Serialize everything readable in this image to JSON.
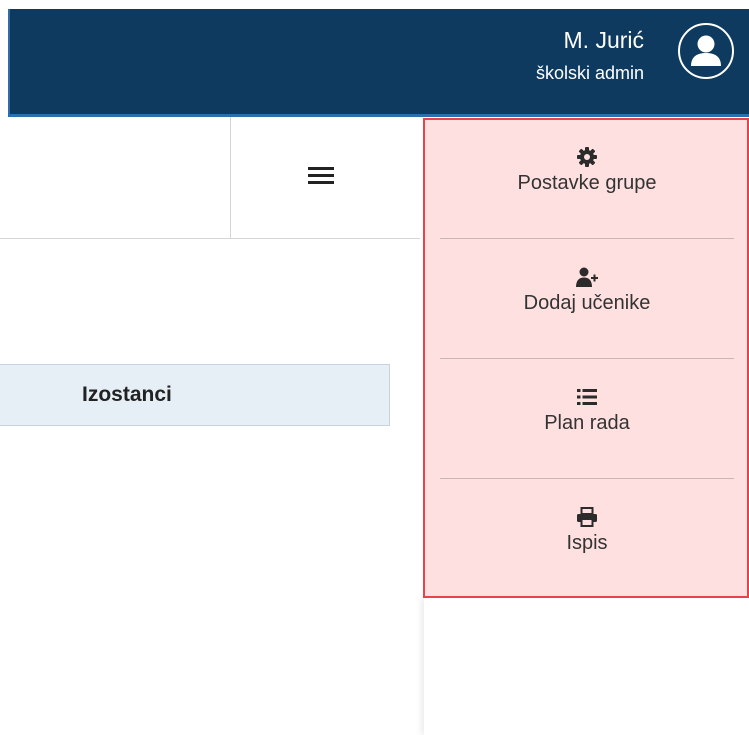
{
  "user": {
    "name": "M. Jurić",
    "role": "školski admin",
    "avatar_icon": "user-icon"
  },
  "toolbar": {
    "menu_icon": "hamburger-icon"
  },
  "table": {
    "columns": [
      "Izostanci"
    ]
  },
  "dropdown_menu": {
    "items": [
      {
        "label": "Postavke grupe",
        "icon": "gear-icon"
      },
      {
        "label": "Dodaj učenike",
        "icon": "user-plus-icon"
      },
      {
        "label": "Plan rada",
        "icon": "list-icon"
      },
      {
        "label": "Ispis",
        "icon": "printer-icon"
      }
    ]
  },
  "colors": {
    "header_bg": "#0e3a5f",
    "menu_bg": "#fee0e0",
    "menu_border": "#e8424a",
    "table_header_bg": "#e6eef6"
  }
}
